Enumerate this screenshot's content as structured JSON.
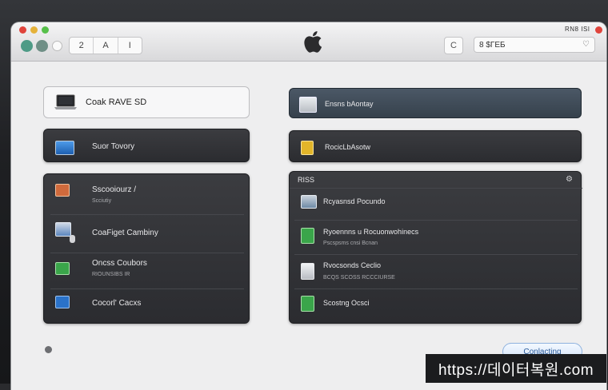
{
  "toolbar": {
    "nav_buttons": [
      "2",
      "A",
      "I"
    ],
    "right_button": "C",
    "search_value": "8 $ГЕБ",
    "top_right_label": "RN8 ISI"
  },
  "left_column": {
    "header_card": {
      "label": "Coak RAVE SD"
    },
    "single_card": {
      "label": "Suor Tovory"
    },
    "list": [
      {
        "title": "Sscooiourz /",
        "subtitle": "Scciutiy"
      },
      {
        "title": "CoaFiget Cambiny",
        "subtitle": ""
      },
      {
        "title": "Oncss Coubors",
        "subtitle": "RIOUNSIBS IR"
      },
      {
        "title": "Cocorl' Cacxs",
        "subtitle": ""
      }
    ]
  },
  "right_column": {
    "header_card": {
      "label": "Ensns bAontay"
    },
    "single_card": {
      "label": "RocicLbAsotw"
    },
    "panel_title": "RISS",
    "list": [
      {
        "title": "Rcyasnsd Pocundo",
        "subtitle": ""
      },
      {
        "title": "Ryoennns u Rocuonwohinecs",
        "subtitle": "Pscspsms cnsi Bcnan"
      },
      {
        "title": "Rvocsonds Ceclio",
        "subtitle": "BCQS SCOSS RCCCIURSE"
      },
      {
        "title": "Scostng Ocsci",
        "subtitle": ""
      }
    ]
  },
  "footer": {
    "continue_label": "Conlacting"
  },
  "watermark": {
    "text": "https://데이터복원.com"
  },
  "colors": {
    "close": "#e0443c",
    "min": "#e5b23a",
    "max": "#57c04a",
    "accent_blue": "#2a72c9"
  }
}
